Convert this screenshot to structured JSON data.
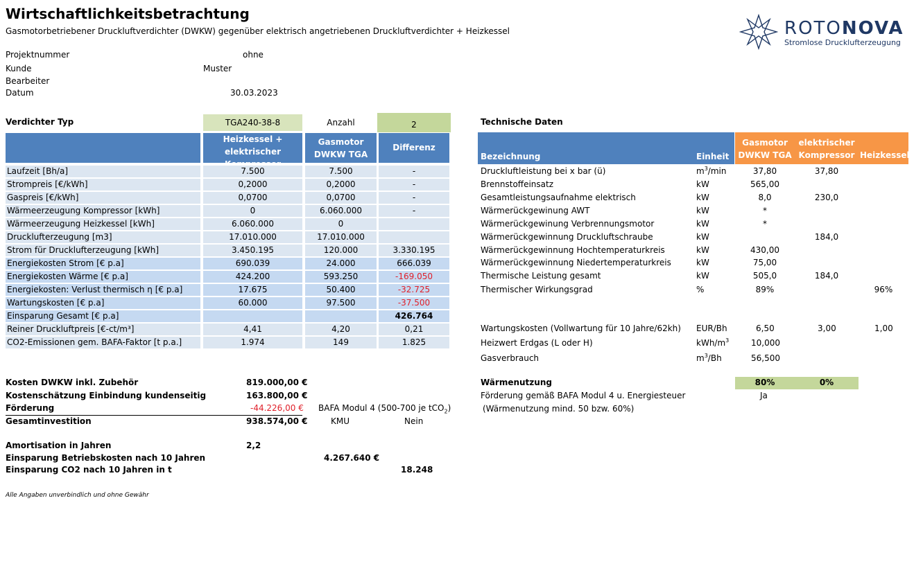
{
  "header": {
    "title": "Wirtschaftlichkeitsbetrachtung",
    "subtitle": "Gasmotorbetriebener Druckluftverdichter (DWKW) gegenüber elektrisch angetriebenen Druckluftverdichter + Heizkessel"
  },
  "logo": {
    "brand_a": "ROTO",
    "brand_b": "NOVA",
    "tagline": "Stromlose Drucklufterzeugung"
  },
  "project": {
    "projektnummer_label": "Projektnummer",
    "projektnummer_value": "ohne",
    "kunde_label": "Kunde",
    "kunde_value": "Muster",
    "bearbeiter_label": "Bearbeiter",
    "datum_label": "Datum",
    "datum_value": "30.03.2023"
  },
  "left_table": {
    "type_label": "Verdichter Typ",
    "type_value": "TGA240-38-8",
    "count_label": "Anzahl",
    "count_value": "2",
    "col1": "Heizkessel + elektrischer Kompressor",
    "col2": "Gasmotor DWKW TGA",
    "col3": "Differenz",
    "rows": [
      {
        "label": "Laufzeit [Bh/a]",
        "v1": "7.500",
        "v2": "7.500",
        "v3": "-"
      },
      {
        "label": "Strompreis [€/kWh]",
        "v1": "0,2000",
        "v2": "0,2000",
        "v3": "-"
      },
      {
        "label": "Gaspreis [€/kWh]",
        "v1": "0,0700",
        "v2": "0,0700",
        "v3": "-"
      },
      {
        "label": "Wärmeerzeugung Kompressor [kWh]",
        "v1": "0",
        "v2": "6.060.000",
        "v3": "-"
      },
      {
        "label": "Wärmeerzeugung Heizkessel [kWh]",
        "v1": "6.060.000",
        "v2": "0",
        "v3": ""
      },
      {
        "label": "Drucklufterzeugung [m3]",
        "v1": "17.010.000",
        "v2": "17.010.000",
        "v3": ""
      },
      {
        "label": "Strom für Drucklufterzeugung [kWh]",
        "v1": "3.450.195",
        "v2": "120.000",
        "v3": "3.330.195"
      },
      {
        "label": "Energiekosten Strom [€ p.a]",
        "v1": "690.039",
        "v2": "24.000",
        "v3": "666.039"
      },
      {
        "label": "Energiekosten Wärme [€ p.a]",
        "v1": "424.200",
        "v2": "593.250",
        "v3": "-169.050"
      },
      {
        "label": "Energiekosten: Verlust thermisch η  [€ p.a]",
        "v1": "17.675",
        "v2": "50.400",
        "v3": "-32.725"
      },
      {
        "label": "Wartungskosten  [€ p.a]",
        "v1": "60.000",
        "v2": "97.500",
        "v3": "-37.500"
      },
      {
        "label": "Einsparung Gesamt   [€ p.a]",
        "v1": "",
        "v2": "",
        "v3": "426.764"
      },
      {
        "label": "Reiner Druckluftpreis [€-ct/m³]",
        "v1": "4,41",
        "v2": "4,20",
        "v3": "0,21"
      },
      {
        "label": "CO2-Emissionen gem. BAFA-Faktor [t p.a.]",
        "v1": "1.974",
        "v2": "149",
        "v3": "1.825"
      }
    ]
  },
  "costs": {
    "kosten_label": "Kosten DWKW inkl. Zubehör",
    "kosten_value": "819.000,00 €",
    "einbindung_label": "Kostenschätzung Einbindung kundenseitig",
    "einbindung_value": "163.800,00 €",
    "foerderung_label": "Förderung",
    "foerderung_value": "-44.226,00 €",
    "bafa_text": "BAFA Modul 4 (500-700 je tCO",
    "bafa_sub": "2",
    "bafa_close": ")",
    "gesamt_label": "Gesamtinvestition",
    "gesamt_value": "938.574,00 €",
    "kmu_label": "KMU",
    "kmu_value": "Nein",
    "amort_label": "Amortisation in Jahren",
    "amort_value": "2,2",
    "einsp_betrieb_label": "Einsparung Betriebskosten nach 10 Jahren",
    "einsp_betrieb_value": "4.267.640 €",
    "einsp_co2_label": "Einsparung CO2 nach 10 Jahren in t",
    "einsp_co2_value": "18.248",
    "disclaimer": "Alle Angaben unverbindlich und ohne Gewähr"
  },
  "tech": {
    "title": "Technische Daten",
    "col_bez": "Bezeichnung",
    "col_einheit": "Einheit",
    "col_gas": "Gasmotor DWKW TGA",
    "col_el": "elektrischer Kompressor",
    "col_hk": "Heizkessel",
    "rows": [
      {
        "label": "Druckluftleistung bei x bar (ü)",
        "unit": "m",
        "unit_sup": "3",
        "unit_rest": "/min",
        "gas": "37,80",
        "el": "37,80",
        "hk": ""
      },
      {
        "label": "Brennstoffeinsatz",
        "unit": "kW",
        "unit_sup": "",
        "unit_rest": "",
        "gas": "565,00",
        "el": "",
        "hk": ""
      },
      {
        "label": "Gesamtleistungsaufnahme elektrisch",
        "unit": "kW",
        "unit_sup": "",
        "unit_rest": "",
        "gas": "8,0",
        "el": "230,0",
        "hk": ""
      },
      {
        "label": "Wärmerückgewinung AWT",
        "unit": "kW",
        "unit_sup": "",
        "unit_rest": "",
        "gas": "*",
        "el": "",
        "hk": ""
      },
      {
        "label": "Wärmerückgewinung Verbrennungsmotor",
        "unit": "kW",
        "unit_sup": "",
        "unit_rest": "",
        "gas": "*",
        "el": "",
        "hk": ""
      },
      {
        "label": "Wärmerückgewinnung Druckluftschraube",
        "unit": "kW",
        "unit_sup": "",
        "unit_rest": "",
        "gas": "",
        "el": "184,0",
        "hk": ""
      },
      {
        "label": "Wärmerückgewinnung Hochtemperaturkreis",
        "unit": "kW",
        "unit_sup": "",
        "unit_rest": "",
        "gas": "430,00",
        "el": "",
        "hk": ""
      },
      {
        "label": "Wärmerückgewinnung Niedertemperaturkreis",
        "unit": "kW",
        "unit_sup": "",
        "unit_rest": "",
        "gas": "75,00",
        "el": "",
        "hk": ""
      },
      {
        "label": "Thermische Leistung gesamt",
        "unit": "kW",
        "unit_sup": "",
        "unit_rest": "",
        "gas": "505,0",
        "el": "184,0",
        "hk": ""
      },
      {
        "label": "Thermischer Wirkungsgrad",
        "unit": "%",
        "unit_sup": "",
        "unit_rest": "",
        "gas": "89%",
        "el": "",
        "hk": "96%"
      }
    ],
    "wartung_label": "Wartungskosten (Vollwartung für 10 Jahre/62kh)",
    "wartung_unit": "EUR/Bh",
    "wartung_gas": "6,50",
    "wartung_el": "3,00",
    "wartung_hk": "1,00",
    "heizwert_label": "Heizwert Erdgas (L oder H)",
    "heizwert_unit": "kWh/m",
    "heizwert_sup": "3",
    "heizwert_gas": "10,000",
    "gasverbrauch_label": "Gasverbrauch",
    "gasverbrauch_unit": "m",
    "gasverbrauch_sup": "3",
    "gasverbrauch_rest": "/Bh",
    "gasverbrauch_gas": "56,500",
    "waerme_label": "Wärmenutzung",
    "waerme_gas": "80%",
    "waerme_el": "0%",
    "foerd_label": "Förderung gemäß BAFA Modul 4 u. Energiesteuer",
    "foerd_value": "Ja",
    "foerd_note": "(Wärmenutzung mind. 50 bzw. 60%)"
  },
  "colors": {
    "header_blue": "#4f81bd",
    "row_light": "#dce6f1",
    "row_mid": "#c5d9f1",
    "green": "#c4d79b",
    "orange": "#f79646",
    "negative": "#e0202a"
  }
}
